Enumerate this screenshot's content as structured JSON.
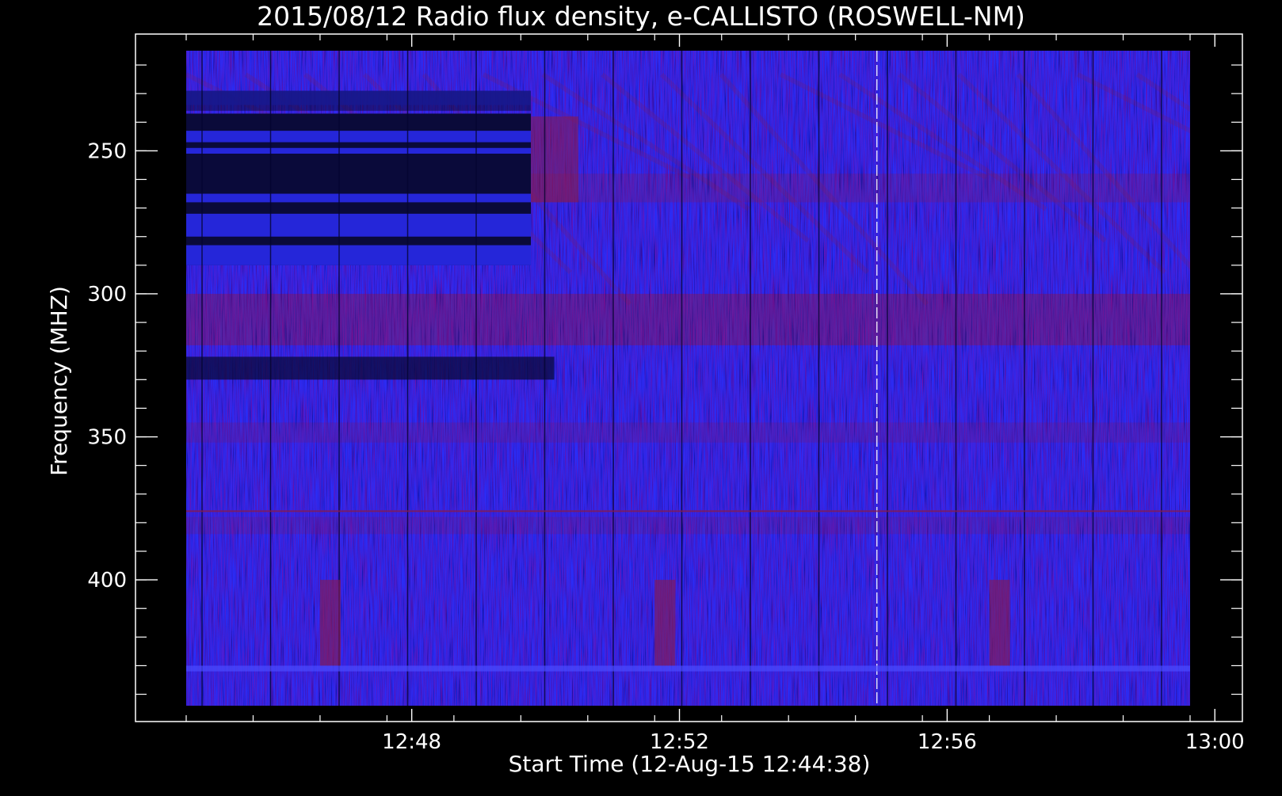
{
  "chart_data": {
    "type": "heatmap",
    "title": "2015/08/12  Radio flux density, e-CALLISTO (ROSWELL-NM)",
    "xlabel": "Start Time (12-Aug-15 12:44:38)",
    "ylabel": "Frequency (MHZ)",
    "x_ticks": [
      "12:48",
      "12:52",
      "12:56",
      "13:00"
    ],
    "x_tick_minutes": [
      3.37,
      7.37,
      11.37,
      15.37
    ],
    "x_range_minutes": [
      0,
      15
    ],
    "y_ticks": [
      "250",
      "300",
      "350",
      "400"
    ],
    "y_tick_values": [
      250,
      300,
      350,
      400
    ],
    "ylim": [
      215,
      444
    ],
    "y_inverted": true,
    "colors": {
      "background": "#000000",
      "axis": "#ffffff",
      "base": "#2a2cf6",
      "bright": "#3a3cff",
      "dark": "#0a0a3a",
      "red_emission": "#8a1a48"
    },
    "features": [
      {
        "kind": "dark-band-block",
        "x_range_minutes": [
          0,
          5.15
        ],
        "y_range": [
          237,
          290
        ]
      },
      {
        "kind": "dark-band",
        "x_range_minutes": [
          0,
          5.5
        ],
        "y_range": [
          322,
          330
        ]
      },
      {
        "kind": "emission-band",
        "y_range": [
          300,
          318
        ]
      },
      {
        "kind": "vertical-line",
        "x_minutes": 10.32
      }
    ]
  }
}
